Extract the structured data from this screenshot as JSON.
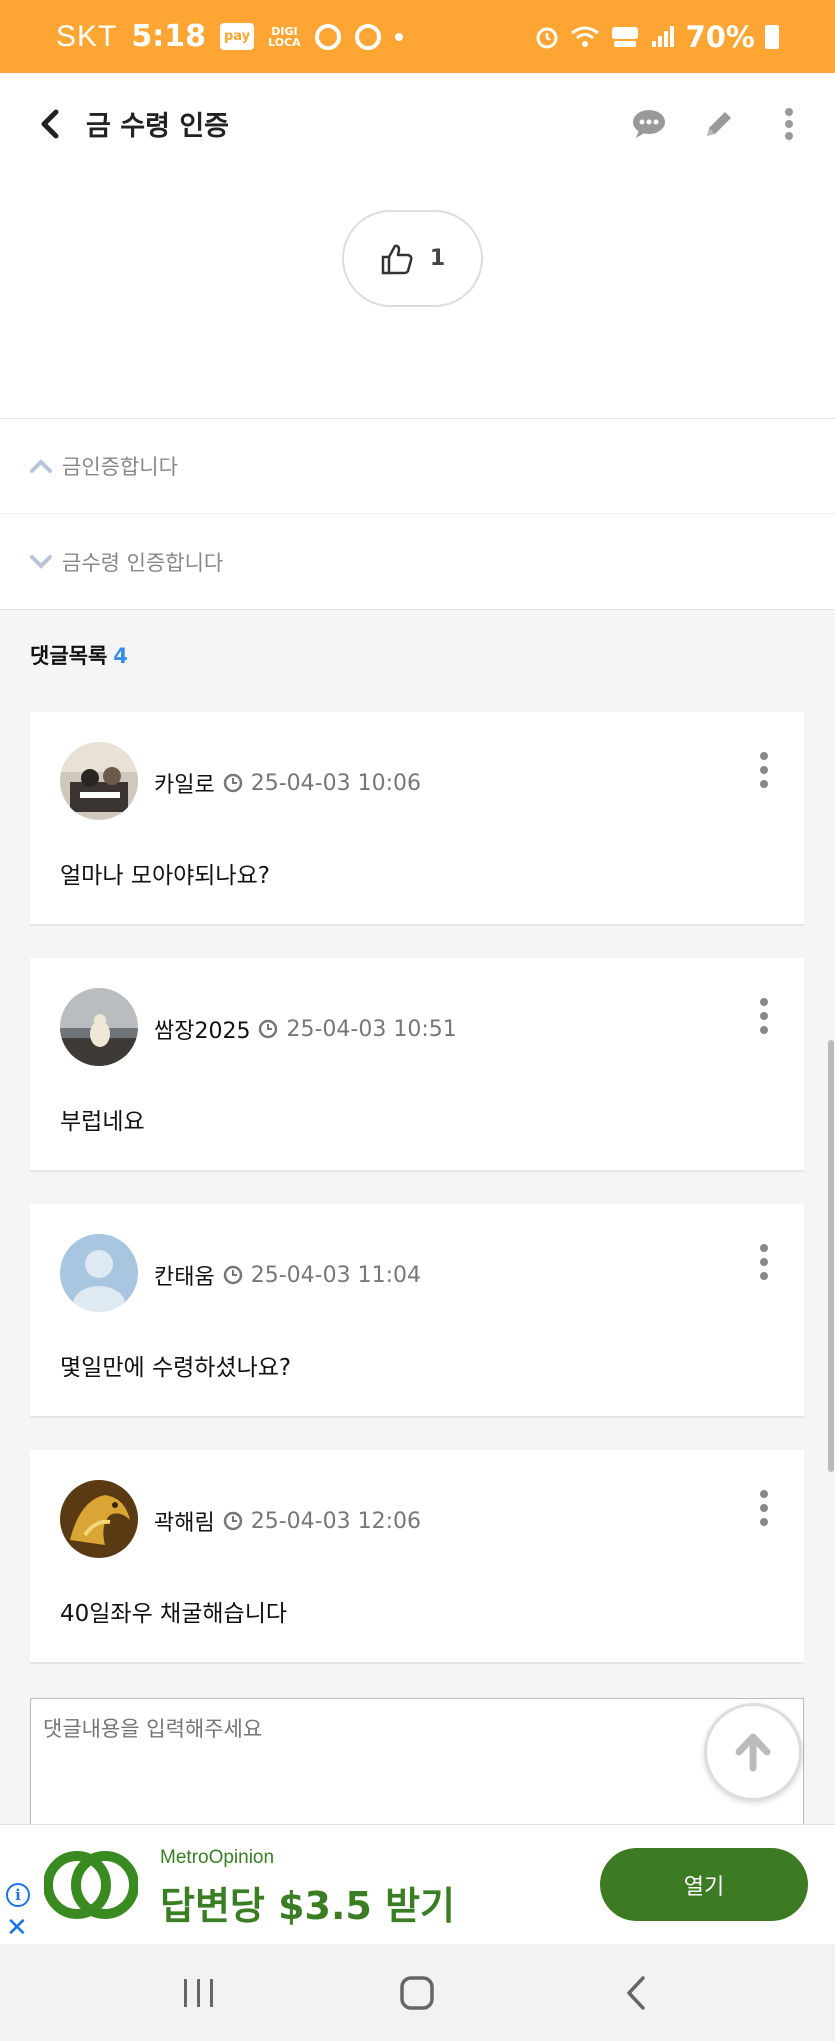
{
  "status_bar": {
    "carrier": "SKT",
    "time": "5:18",
    "pay_badge": "pay",
    "digi_badge_line1": "DIGI",
    "digi_badge_line2": "LOCA",
    "battery": "70%"
  },
  "app_bar": {
    "title": "금 수령 인증"
  },
  "post": {
    "like_count": "1"
  },
  "post_nav": {
    "prev_title": "금인증합니다",
    "next_title": "금수령 인증합니다"
  },
  "comments": {
    "header_label": "댓글목록",
    "count": "4",
    "items": [
      {
        "author": "카일로",
        "date": "25-04-03 10:06",
        "text": "얼마나 모아야되나요?"
      },
      {
        "author": "쌈장2025",
        "date": "25-04-03 10:51",
        "text": "부럽네요"
      },
      {
        "author": "칸태움",
        "date": "25-04-03 11:04",
        "text": "몇일만에 수령하셨나요?"
      },
      {
        "author": "곽해림",
        "date": "25-04-03 12:06",
        "text": "40일좌우 채굴해습니다"
      }
    ]
  },
  "comment_input": {
    "placeholder": "댓글내용을 입력해주세요"
  },
  "ad": {
    "brand": "MetroOpinion",
    "headline": "답변당 $3.5 받기",
    "cta": "열기"
  },
  "colors": {
    "status_bar": "#ffa534",
    "accent_blue": "#3a8ee6",
    "ad_green": "#3d7a24"
  }
}
